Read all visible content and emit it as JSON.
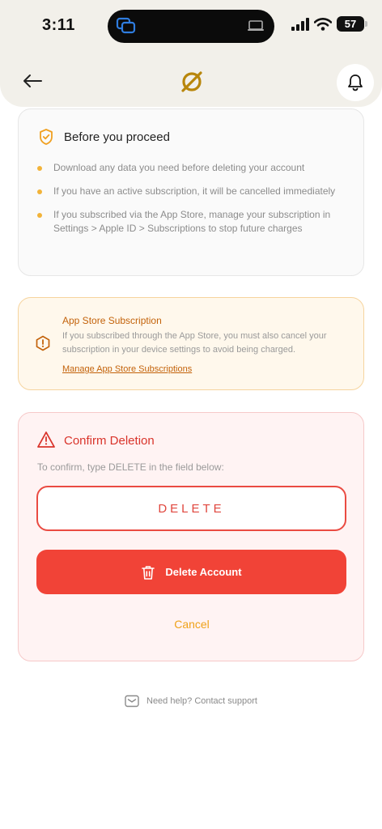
{
  "status_bar": {
    "time": "3:11",
    "battery": "57"
  },
  "header": {},
  "proceed": {
    "title": "Before you proceed",
    "items": [
      "Download any data you need before deleting your account",
      "If you have an active subscription, it will be cancelled immediately",
      "If you subscribed via the App Store, manage your subscription in Settings > Apple ID > Subscriptions to stop future charges"
    ]
  },
  "app_store": {
    "title": "App Store Subscription",
    "text": "If you subscribed through the App Store, you must also cancel your subscription in your device settings to avoid being charged.",
    "link": "Manage App Store Subscriptions"
  },
  "confirm": {
    "title": "Confirm Deletion",
    "instruction": "To confirm, type DELETE in the field below:",
    "input_value": "DELETE",
    "delete_button": "Delete Account",
    "cancel": "Cancel"
  },
  "help": {
    "text": "Need help? Contact support"
  },
  "colors": {
    "accent_orange": "#efa21a",
    "danger": "#f14337",
    "brand_gold": "#b8860b"
  }
}
